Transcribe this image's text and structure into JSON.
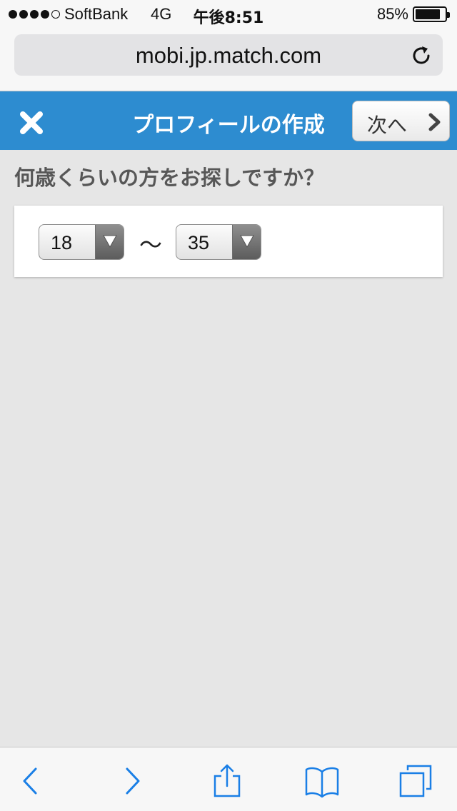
{
  "status_bar": {
    "carrier": "SoftBank",
    "network": "4G",
    "time": "午後8:51",
    "battery_percent": "85%",
    "battery_level": 0.85,
    "signal_bars": 4,
    "signal_max": 5
  },
  "browser": {
    "url": "mobi.jp.match.com"
  },
  "header": {
    "title": "プロフィールの作成",
    "next_label": "次へ"
  },
  "question": "何歳くらいの方をお探しですか？",
  "age_range": {
    "min_value": "18",
    "separator": "〜",
    "max_value": "35"
  },
  "colors": {
    "header_blue": "#2d8cd0",
    "toolbar_icon_blue": "#1a7fe6"
  },
  "icons": [
    "reload-icon",
    "close-icon",
    "chevron-right-icon",
    "chevron-down-icon",
    "back-icon",
    "forward-icon",
    "share-icon",
    "bookmarks-icon",
    "tabs-icon"
  ]
}
